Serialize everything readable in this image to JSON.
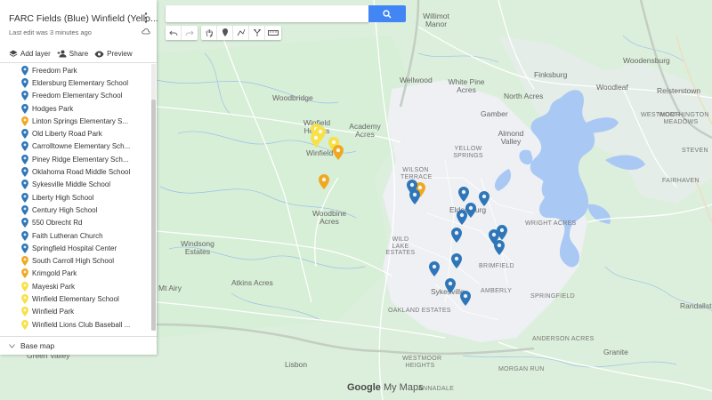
{
  "panel": {
    "title": "FARC Fields (Blue) Winfield (Yello...",
    "last_edit": "Last edit was 3 minutes ago",
    "add_layer": "Add layer",
    "share": "Share",
    "preview": "Preview",
    "base_map": "Base map"
  },
  "layers": [
    {
      "label": "Freedom Park",
      "color": "#2f76b8"
    },
    {
      "label": "Eldersburg Elementary School",
      "color": "#2f76b8"
    },
    {
      "label": "Freedom Elementary School",
      "color": "#2f76b8"
    },
    {
      "label": "Hodges Park",
      "color": "#2f76b8"
    },
    {
      "label": "Linton Springs Elementary S...",
      "color": "#f0a823"
    },
    {
      "label": "Old Liberty Road Park",
      "color": "#2f76b8"
    },
    {
      "label": "Carrolltowne Elementary Sch...",
      "color": "#2f76b8"
    },
    {
      "label": "Piney Ridge Elementary Sch...",
      "color": "#2f76b8"
    },
    {
      "label": "Oklahoma Road Middle School",
      "color": "#2f76b8"
    },
    {
      "label": "Sykesville Middle School",
      "color": "#2f76b8"
    },
    {
      "label": "Liberty High School",
      "color": "#2f76b8"
    },
    {
      "label": "Century High School",
      "color": "#2f76b8"
    },
    {
      "label": "550 Obrecht Rd",
      "color": "#2f76b8"
    },
    {
      "label": "Faith Lutheran Church",
      "color": "#2f76b8"
    },
    {
      "label": "Springfield Hospital Center",
      "color": "#2f76b8"
    },
    {
      "label": "South Carroll High School",
      "color": "#f0a823"
    },
    {
      "label": "Krimgold Park",
      "color": "#f0a823"
    },
    {
      "label": "Mayeski Park",
      "color": "#f8e047"
    },
    {
      "label": "Winfield Elementary School",
      "color": "#f8e047"
    },
    {
      "label": "Winfield Park",
      "color": "#f8e047"
    },
    {
      "label": "Winfield Lions Club Baseball ...",
      "color": "#f8e047"
    }
  ],
  "map_labels": {
    "woodbridge": "Woodbridge",
    "winfield_heights": "Winfield Heights",
    "academy_acres": "Academy Acres",
    "winfield": "Winfield",
    "woodbine_acres": "Woodbine Acres",
    "windsong_estates": "Windsong Estates",
    "mt_airy": "Mt Airy",
    "atkins_acres": "Atkins Acres",
    "green_valley": "Green Valley",
    "lisbon": "Lisbon",
    "willimot_manor": "Willimot Manor",
    "wellwood": "Wellwood",
    "white_pine_acres": "White Pine Acres",
    "north_acres": "North Acres",
    "finksburg": "Finksburg",
    "woodensburg": "Woodensburg",
    "woodleaf": "Woodleaf",
    "reisterstown": "Reisterstown",
    "gamber": "Gamber",
    "almond_valley": "Almond Valley",
    "yellow_springs": "YELLOW SPRINGS",
    "wilson_terrace": "WILSON TERRACE",
    "eldersburg": "Eldersburg",
    "wright_acres": "WRIGHT ACRES",
    "wild_lake_estates": "WILD LAKE ESTATES",
    "sykesville": "Sykesville",
    "oakland_estates": "OAKLAND ESTATES",
    "granite": "Granite",
    "randallstown": "Randallst",
    "westmoor": "WESTMOOR",
    "worthington_meadows": "WORTHINGTON MEADOWS",
    "stevenson": "STEVEN",
    "amberly": "AMBERLY",
    "springfield": "SPRINGFIELD",
    "westmoor_heights": "WESTMOOR HEIGHTS",
    "annadale": "ANNADALE",
    "morgan_run": "MORGAN RUN",
    "fairhaven": "FAIRHAVEN",
    "brimfield": "BRIMFIELD",
    "anderson_acres": "ANDERSON ACRES"
  },
  "logo": {
    "google": "Google",
    "mymaps": "My Maps"
  },
  "colors": {
    "blue_pin": "#2f76b8",
    "orange_pin": "#f0a823",
    "yellow_pin": "#f8e047",
    "water": "#aac8f4",
    "land": "#dff0df",
    "urban": "#eceff3",
    "road": "#ffffff",
    "highway": "#c9d6c9"
  }
}
